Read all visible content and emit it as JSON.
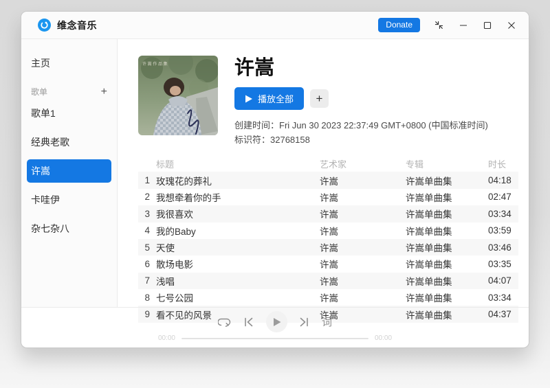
{
  "window": {
    "app_title": "维念音乐",
    "donate_label": "Donate"
  },
  "sidebar": {
    "home_label": "主页",
    "section_label": "歌单",
    "add_label": "+",
    "playlists": [
      {
        "label": "歌单1",
        "selected": false
      },
      {
        "label": "经典老歌",
        "selected": false
      },
      {
        "label": "许嵩",
        "selected": true
      },
      {
        "label": "卡哇伊",
        "selected": false
      },
      {
        "label": "杂七杂八",
        "selected": false
      }
    ]
  },
  "playlist": {
    "title": "许嵩",
    "play_all_label": "播放全部",
    "add_label": "+",
    "created_label": "创建时间：",
    "created_value": "Fri Jun 30 2023 22:37:49 GMT+0800 (中国标准时间)",
    "id_label": "标识符：",
    "id_value": "32768158"
  },
  "table": {
    "columns": {
      "title": "标题",
      "artist": "艺术家",
      "album": "专辑",
      "duration": "时长"
    },
    "rows": [
      {
        "index": "1",
        "title": "玫瑰花的葬礼",
        "artist": "许嵩",
        "album": "许嵩单曲集",
        "duration": "04:18"
      },
      {
        "index": "2",
        "title": "我想牵着你的手",
        "artist": "许嵩",
        "album": "许嵩单曲集",
        "duration": "02:47"
      },
      {
        "index": "3",
        "title": "我很喜欢",
        "artist": "许嵩",
        "album": "许嵩单曲集",
        "duration": "03:34"
      },
      {
        "index": "4",
        "title": "我的Baby",
        "artist": "许嵩",
        "album": "许嵩单曲集",
        "duration": "03:59"
      },
      {
        "index": "5",
        "title": "天使",
        "artist": "许嵩",
        "album": "许嵩单曲集",
        "duration": "03:46"
      },
      {
        "index": "6",
        "title": "散场电影",
        "artist": "许嵩",
        "album": "许嵩单曲集",
        "duration": "03:35"
      },
      {
        "index": "7",
        "title": "浅唱",
        "artist": "许嵩",
        "album": "许嵩单曲集",
        "duration": "04:07"
      },
      {
        "index": "8",
        "title": "七号公园",
        "artist": "许嵩",
        "album": "许嵩单曲集",
        "duration": "03:34"
      },
      {
        "index": "9",
        "title": "看不见的风景",
        "artist": "许嵩",
        "album": "许嵩单曲集",
        "duration": "04:37"
      }
    ]
  },
  "player": {
    "lyrics_label": "词",
    "current_time": "00:00",
    "total_time": "00:00"
  },
  "colors": {
    "accent": "#1478e3",
    "logo": "#1b96ef",
    "zebra": "#f7f7f7"
  }
}
